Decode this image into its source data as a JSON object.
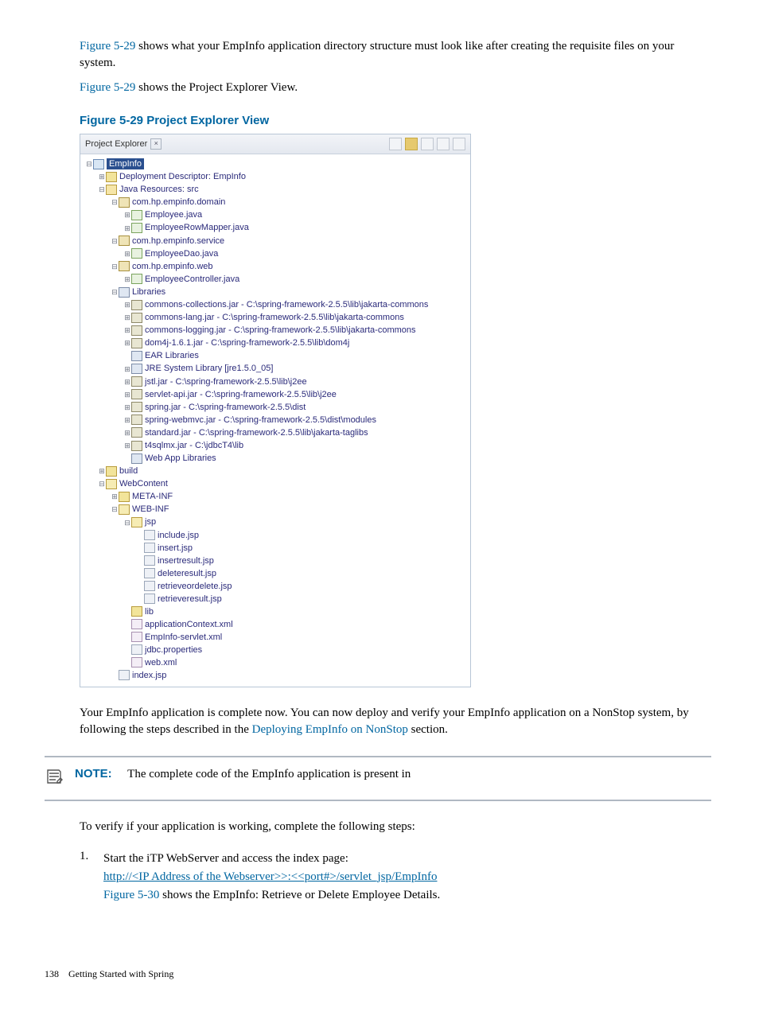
{
  "para1_pre": "Figure 5-29",
  "para1_post": " shows what your EmpInfo application directory structure must look like after creating the requisite files on your system.",
  "para2_pre": "Figure 5-29",
  "para2_post": " shows the Project Explorer View.",
  "figure_caption": "Figure 5-29 Project Explorer View",
  "explorer": {
    "title": "Project Explorer",
    "tree": [
      {
        "d": 0,
        "t": "⊟",
        "icon": "proj",
        "label": "EmpInfo",
        "sel": true
      },
      {
        "d": 1,
        "t": "⊞",
        "icon": "folder",
        "label": "Deployment Descriptor: EmpInfo"
      },
      {
        "d": 1,
        "t": "⊟",
        "icon": "java-res",
        "label": "Java Resources: src"
      },
      {
        "d": 2,
        "t": "⊟",
        "icon": "pkg",
        "label": "com.hp.empinfo.domain"
      },
      {
        "d": 3,
        "t": "⊞",
        "icon": "java",
        "label": "Employee.java"
      },
      {
        "d": 3,
        "t": "⊞",
        "icon": "java",
        "label": "EmployeeRowMapper.java"
      },
      {
        "d": 2,
        "t": "⊟",
        "icon": "pkg",
        "label": "com.hp.empinfo.service"
      },
      {
        "d": 3,
        "t": "⊞",
        "icon": "java",
        "label": "EmployeeDao.java"
      },
      {
        "d": 2,
        "t": "⊟",
        "icon": "pkg",
        "label": "com.hp.empinfo.web"
      },
      {
        "d": 3,
        "t": "⊞",
        "icon": "java",
        "label": "EmployeeController.java"
      },
      {
        "d": 2,
        "t": "⊟",
        "icon": "lib",
        "label": "Libraries"
      },
      {
        "d": 3,
        "t": "⊞",
        "icon": "jar",
        "label": "commons-collections.jar - C:\\spring-framework-2.5.5\\lib\\jakarta-commons"
      },
      {
        "d": 3,
        "t": "⊞",
        "icon": "jar",
        "label": "commons-lang.jar - C:\\spring-framework-2.5.5\\lib\\jakarta-commons"
      },
      {
        "d": 3,
        "t": "⊞",
        "icon": "jar",
        "label": "commons-logging.jar - C:\\spring-framework-2.5.5\\lib\\jakarta-commons"
      },
      {
        "d": 3,
        "t": "⊞",
        "icon": "jar",
        "label": "dom4j-1.6.1.jar - C:\\spring-framework-2.5.5\\lib\\dom4j"
      },
      {
        "d": 3,
        "t": "",
        "icon": "lib",
        "label": "EAR Libraries"
      },
      {
        "d": 3,
        "t": "⊞",
        "icon": "lib",
        "label": "JRE System Library [jre1.5.0_05]"
      },
      {
        "d": 3,
        "t": "⊞",
        "icon": "jar",
        "label": "jstl.jar - C:\\spring-framework-2.5.5\\lib\\j2ee"
      },
      {
        "d": 3,
        "t": "⊞",
        "icon": "jar",
        "label": "servlet-api.jar - C:\\spring-framework-2.5.5\\lib\\j2ee"
      },
      {
        "d": 3,
        "t": "⊞",
        "icon": "jar",
        "label": "spring.jar - C:\\spring-framework-2.5.5\\dist"
      },
      {
        "d": 3,
        "t": "⊞",
        "icon": "jar",
        "label": "spring-webmvc.jar - C:\\spring-framework-2.5.5\\dist\\modules"
      },
      {
        "d": 3,
        "t": "⊞",
        "icon": "jar",
        "label": "standard.jar - C:\\spring-framework-2.5.5\\lib\\jakarta-taglibs"
      },
      {
        "d": 3,
        "t": "⊞",
        "icon": "jar",
        "label": "t4sqlmx.jar - C:\\jdbcT4\\lib"
      },
      {
        "d": 3,
        "t": "",
        "icon": "lib",
        "label": "Web App Libraries"
      },
      {
        "d": 1,
        "t": "⊞",
        "icon": "folder",
        "label": "build"
      },
      {
        "d": 1,
        "t": "⊟",
        "icon": "folder-open",
        "label": "WebContent"
      },
      {
        "d": 2,
        "t": "⊞",
        "icon": "folder",
        "label": "META-INF"
      },
      {
        "d": 2,
        "t": "⊟",
        "icon": "folder-open",
        "label": "WEB-INF"
      },
      {
        "d": 3,
        "t": "⊟",
        "icon": "folder-open",
        "label": "jsp"
      },
      {
        "d": 4,
        "t": "",
        "icon": "file",
        "label": "include.jsp"
      },
      {
        "d": 4,
        "t": "",
        "icon": "file",
        "label": "insert.jsp"
      },
      {
        "d": 4,
        "t": "",
        "icon": "file",
        "label": "insertresult.jsp"
      },
      {
        "d": 4,
        "t": "",
        "icon": "file",
        "label": "deleteresult.jsp"
      },
      {
        "d": 4,
        "t": "",
        "icon": "file",
        "label": "retrieveordelete.jsp"
      },
      {
        "d": 4,
        "t": "",
        "icon": "file",
        "label": "retrieveresult.jsp"
      },
      {
        "d": 3,
        "t": "",
        "icon": "folder",
        "label": "lib"
      },
      {
        "d": 3,
        "t": "",
        "icon": "xml",
        "label": "applicationContext.xml"
      },
      {
        "d": 3,
        "t": "",
        "icon": "xml",
        "label": "EmpInfo-servlet.xml"
      },
      {
        "d": 3,
        "t": "",
        "icon": "file",
        "label": "jdbc.properties"
      },
      {
        "d": 3,
        "t": "",
        "icon": "xml",
        "label": "web.xml"
      },
      {
        "d": 2,
        "t": "",
        "icon": "file",
        "label": "index.jsp"
      }
    ]
  },
  "para3_a": "Your EmpInfo application is complete now. You can now deploy and verify your EmpInfo application on a NonStop system, by following the steps described in the ",
  "para3_link": "Deploying EmpInfo on NonStop",
  "para3_b": " section.",
  "note_label": "NOTE:",
  "note_text": "The complete code of the EmpInfo application is present in",
  "verify_text": "To verify if your application is working, complete the following steps:",
  "step1_num": "1.",
  "step1_a": "Start the iTP WebServer and access the index page:",
  "step1_url": "http://<IP Address of the Webserver>>:<<port#>/servlet_jsp/EmpInfo",
  "step1_b_pre": "Figure 5-30",
  "step1_b_post": " shows the EmpInfo: Retrieve or Delete Employee Details.",
  "footer_page": "138",
  "footer_text": "Getting Started with Spring"
}
